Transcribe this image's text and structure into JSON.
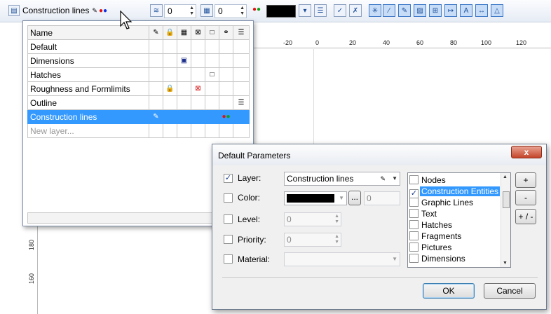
{
  "toolbar": {
    "layer_name": "Construction lines",
    "level_value": "0",
    "priority_value": "0",
    "color_swatch": "#000000"
  },
  "ruler_top": [
    "-20",
    "0",
    "20",
    "40",
    "60",
    "80",
    "100",
    "120"
  ],
  "ruler_left": [
    "180",
    "160"
  ],
  "layers": {
    "header": "Name",
    "rows": [
      {
        "name": "Default",
        "selected": false
      },
      {
        "name": "Dimensions",
        "selected": false
      },
      {
        "name": "Hatches",
        "selected": false
      },
      {
        "name": "Roughness and Formlimits",
        "selected": false
      },
      {
        "name": "Outline",
        "selected": false
      },
      {
        "name": "Construction lines",
        "selected": true
      }
    ],
    "new_layer": "New layer..."
  },
  "dialog": {
    "title": "Default Parameters",
    "close": "x",
    "layer_label": "Layer:",
    "layer_value": "Construction lines",
    "color_label": "Color:",
    "color_value": "0",
    "color_swatch": "#000000",
    "ellipsis": "...",
    "level_label": "Level:",
    "level_value": "0",
    "priority_label": "Priority:",
    "priority_value": "0",
    "material_label": "Material:",
    "material_value": "",
    "entities": [
      {
        "label": "Nodes",
        "checked": false
      },
      {
        "label": "Construction Entities",
        "checked": true
      },
      {
        "label": "Graphic Lines",
        "checked": false
      },
      {
        "label": "Text",
        "checked": false
      },
      {
        "label": "Hatches",
        "checked": false
      },
      {
        "label": "Fragments",
        "checked": false
      },
      {
        "label": "Pictures",
        "checked": false
      },
      {
        "label": "Dimensions",
        "checked": false
      }
    ],
    "plus": "+",
    "minus": "-",
    "plus_minus": "+ / -",
    "ok": "OK",
    "cancel": "Cancel"
  }
}
